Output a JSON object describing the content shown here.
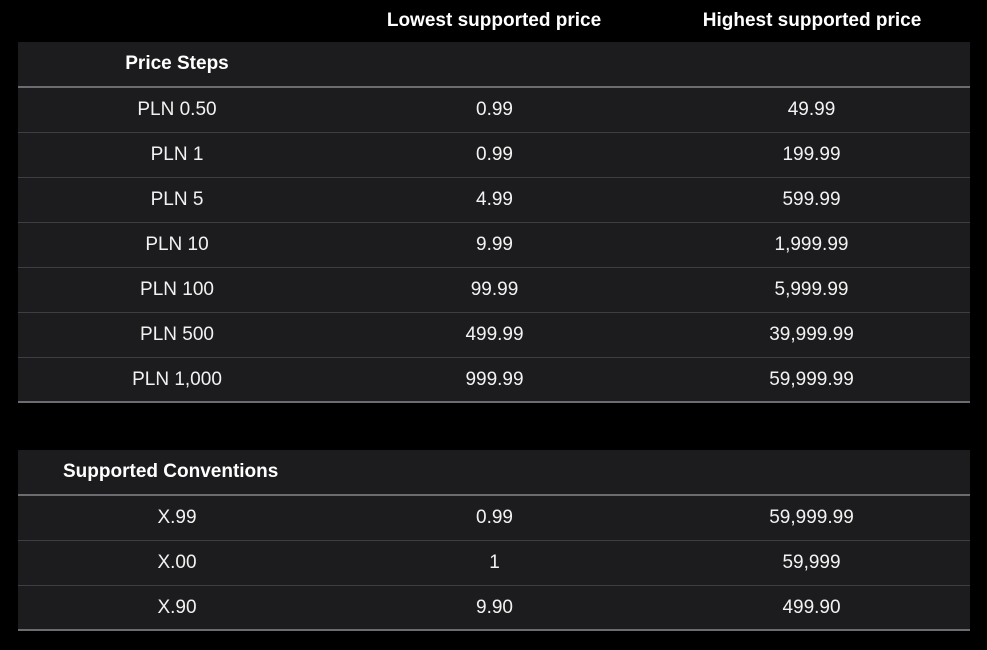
{
  "columns": {
    "lowest": "Lowest supported price",
    "highest": "Highest supported price"
  },
  "price_steps": {
    "title": "Price Steps",
    "rows": [
      {
        "step": "PLN 0.50",
        "lowest": "0.99",
        "highest": "49.99"
      },
      {
        "step": "PLN 1",
        "lowest": "0.99",
        "highest": "199.99"
      },
      {
        "step": "PLN 5",
        "lowest": "4.99",
        "highest": "599.99"
      },
      {
        "step": "PLN 10",
        "lowest": "9.99",
        "highest": "1,999.99"
      },
      {
        "step": "PLN 100",
        "lowest": "99.99",
        "highest": "5,999.99"
      },
      {
        "step": "PLN 500",
        "lowest": "499.99",
        "highest": "39,999.99"
      },
      {
        "step": "PLN 1,000",
        "lowest": "999.99",
        "highest": "59,999.99"
      }
    ]
  },
  "supported_conventions": {
    "title": "Supported Conventions",
    "rows": [
      {
        "convention": "X.99",
        "lowest": "0.99",
        "highest": "59,999.99"
      },
      {
        "convention": "X.00",
        "lowest": "1",
        "highest": "59,999"
      },
      {
        "convention": "X.90",
        "lowest": "9.90",
        "highest": "499.90"
      }
    ]
  }
}
